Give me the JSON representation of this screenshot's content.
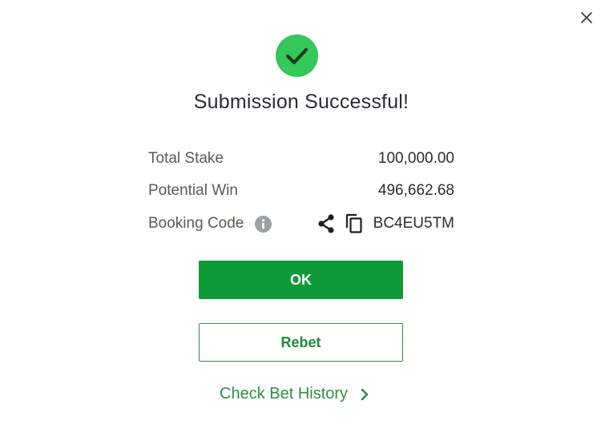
{
  "dialog": {
    "title": "Submission Successful!",
    "close_icon": "close-icon",
    "status_icon": "check-circle-icon"
  },
  "summary": {
    "total_stake": {
      "label": "Total Stake",
      "value": "100,000.00"
    },
    "potential_win": {
      "label": "Potential Win",
      "value": "496,662.68"
    },
    "booking_code": {
      "label": "Booking Code",
      "code": "BC4EU5TM",
      "info_icon": "info-icon",
      "share_icon": "share-icon",
      "copy_icon": "copy-icon"
    }
  },
  "actions": {
    "ok_label": "OK",
    "rebet_label": "Rebet",
    "history_label": "Check Bet History",
    "history_icon": "chevron-right-icon"
  },
  "colors": {
    "primary_green": "#0f9a38",
    "success_icon_green": "#34c759",
    "link_green": "#2e8d47",
    "text_dark": "#2a2d33",
    "text_muted": "#555a62",
    "info_grey": "#9aa0a8"
  }
}
